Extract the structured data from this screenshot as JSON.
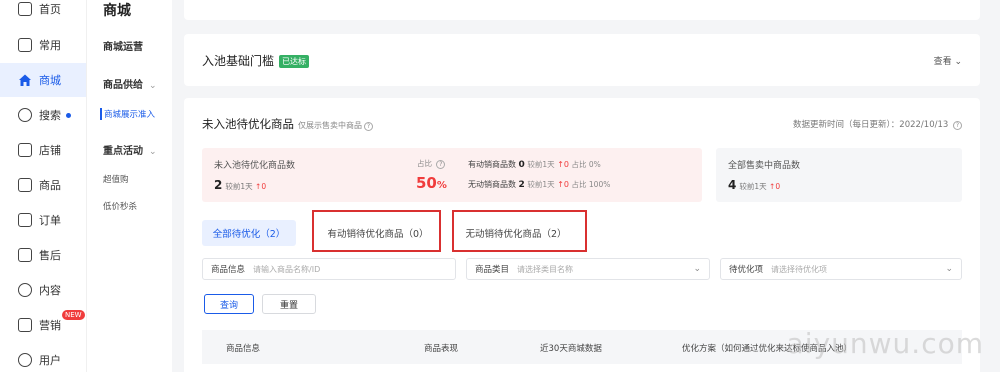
{
  "nav": {
    "items": [
      {
        "label": "首页",
        "icon": "home-icon"
      },
      {
        "label": "常用",
        "icon": "bookmark-icon"
      },
      {
        "label": "商城",
        "icon": "store-icon",
        "active": true
      },
      {
        "label": "搜索",
        "icon": "search-icon"
      },
      {
        "label": "店铺",
        "icon": "shop-icon"
      },
      {
        "label": "商品",
        "icon": "product-icon"
      },
      {
        "label": "订单",
        "icon": "order-icon"
      },
      {
        "label": "售后",
        "icon": "aftersale-icon"
      },
      {
        "label": "内容",
        "icon": "content-icon"
      },
      {
        "label": "营销",
        "icon": "marketing-icon",
        "badge": "NEW"
      },
      {
        "label": "用户",
        "icon": "user-icon"
      }
    ]
  },
  "subnav": {
    "title": "商城",
    "sections": [
      {
        "label": "商城运营"
      },
      {
        "label": "商品供给"
      },
      {
        "label": "商城展示准入"
      },
      {
        "label": "重点活动"
      },
      {
        "label": "超值购"
      },
      {
        "label": "低价秒杀"
      }
    ]
  },
  "pool": {
    "title": "入池基础门槛",
    "tag": "已达标",
    "view": "查看"
  },
  "opt": {
    "title": "未入池待优化商品",
    "subtitle": "仅展示售卖中商品",
    "update_time": "数据更新时间（每日更新）：2022/10/13",
    "stat1": {
      "label": "未入池待优化商品数",
      "value": "2",
      "compare": "较前1天",
      "delta": "↑0",
      "pct_label": "占比",
      "pct": "50",
      "pct_unit": "%"
    },
    "stat2": {
      "active_label": "有动销商品数",
      "active_value": "0",
      "active_compare": "较前1天",
      "active_delta": "↑0",
      "active_pct": "占比 0%",
      "inactive_label": "无动销商品数",
      "inactive_value": "2",
      "inactive_compare": "较前1天",
      "inactive_delta": "↑0",
      "inactive_pct": "占比 100%"
    },
    "stat3": {
      "label": "全部售卖中商品数",
      "value": "4",
      "compare": "较前1天",
      "delta": "↑0"
    },
    "tabs": [
      {
        "label": "全部待优化（2）"
      },
      {
        "label": "有动销待优化商品（0）"
      },
      {
        "label": "无动销待优化商品（2）"
      }
    ],
    "filters": {
      "info_label": "商品信息",
      "info_placeholder": "请输入商品名称/ID",
      "category_label": "商品类目",
      "category_placeholder": "请选择类目名称",
      "item_label": "待优化项",
      "item_placeholder": "请选择待优化项"
    },
    "buttons": {
      "query": "查询",
      "reset": "重置"
    },
    "columns": [
      "商品信息",
      "商品表现",
      "近30天商城数据",
      "优化方案（如何通过优化来达标使商品入池）"
    ]
  },
  "watermark": "aiyunwu.com"
}
